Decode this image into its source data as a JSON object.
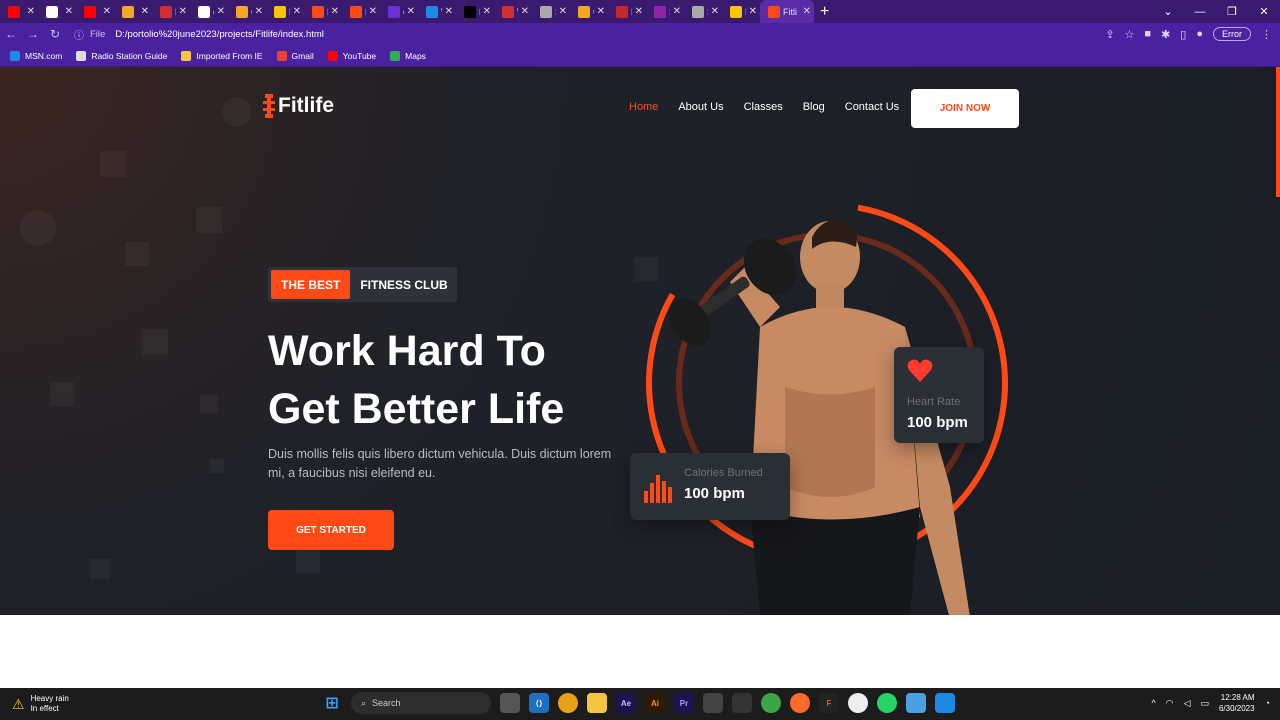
{
  "browser": {
    "tabs": [
      {
        "label": "",
        "color": "#ff0000"
      },
      {
        "label": "",
        "color": "#ffffff"
      },
      {
        "label": "",
        "color": "#ff0000"
      },
      {
        "label": "",
        "color": "#f5a623"
      },
      {
        "label": "Best",
        "color": "#d32f2f"
      },
      {
        "label": "code",
        "color": "#ffffff"
      },
      {
        "label": "Grill",
        "color": "#f5a623"
      },
      {
        "label": "Film",
        "color": "#f7c600"
      },
      {
        "label": "Fitlif",
        "color": "#ff4a17"
      },
      {
        "label": "Fitlif",
        "color": "#ff4a17"
      },
      {
        "label": "devi",
        "color": "#6b2fd6"
      },
      {
        "label": "Wh",
        "color": "#1e88e5"
      },
      {
        "label": "Mal",
        "color": "#000000"
      },
      {
        "label": "Wo",
        "color": "#d32f2f"
      },
      {
        "label": "Stor",
        "color": "#aaaaaa"
      },
      {
        "label": "Grill",
        "color": "#f5a623"
      },
      {
        "label": "Mus",
        "color": "#c62828"
      },
      {
        "label": "Swa",
        "color": "#8e24aa"
      },
      {
        "label": "Stor",
        "color": "#aaaaaa"
      },
      {
        "label": "Free",
        "color": "#f7c600"
      },
      {
        "label": "Fitli",
        "color": "#ff4a17"
      }
    ],
    "new_tab": "+",
    "file_label": "File",
    "url": "D:/portolio%20june2023/projects/Fitlife/index.html",
    "error_label": "Error",
    "bookmarks": [
      {
        "label": "MSN.com",
        "color": "#1e88e5"
      },
      {
        "label": "Radio Station Guide",
        "color": "#dddddd"
      },
      {
        "label": "Imported From IE",
        "color": "#f5c542"
      },
      {
        "label": "Gmail",
        "color": "#ea4335"
      },
      {
        "label": "YouTube",
        "color": "#ff0000"
      },
      {
        "label": "Maps",
        "color": "#34a853"
      }
    ]
  },
  "site": {
    "logo": "Fitlife",
    "nav": [
      "Home",
      "About Us",
      "Classes",
      "Blog",
      "Contact Us"
    ],
    "join_label": "JOIN NOW",
    "badge_highlight": "THE BEST",
    "badge_text": "FITNESS CLUB",
    "headline_line1": "Work Hard To",
    "headline_line2": "Get Better Life",
    "description": "Duis mollis felis quis libero dictum vehicula. Duis dictum lorem mi, a faucibus nisi eleifend eu.",
    "cta_label": "GET STARTED",
    "heart_card": {
      "label": "Heart Rate",
      "value": "100 bpm"
    },
    "calories_card": {
      "label": "Calories Burned",
      "value": "100 bpm"
    },
    "accent": "#ff4a17"
  },
  "taskbar": {
    "weather_title": "Heavy rain",
    "weather_sub": "In effect",
    "search_placeholder": "Search",
    "time": "12:28 AM",
    "date": "6/30/2023"
  }
}
